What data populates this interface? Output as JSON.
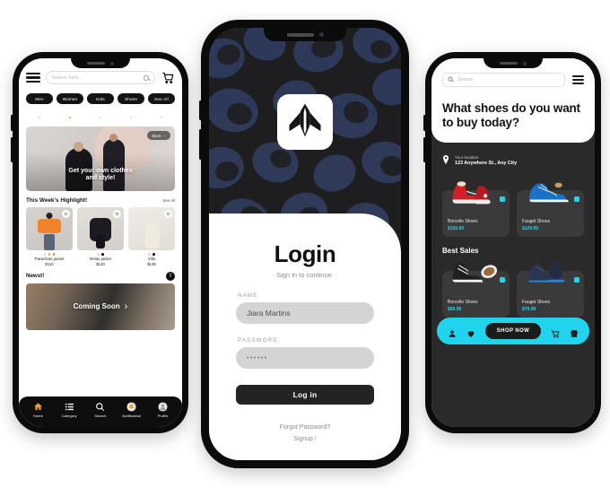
{
  "theme": {
    "accent_cyan": "#22d3ee",
    "accent_orange": "#f0a030",
    "dark": "#131313",
    "page_background": "#ffffff"
  },
  "phone1": {
    "name": "shop-home-screen",
    "header": {
      "menu_icon": "hamburger-icon",
      "search_placeholder": "Search here...",
      "search_icon": "search-icon",
      "cart_icon": "shopping-cart-icon"
    },
    "category_pills": [
      {
        "label": "Men",
        "active": false
      },
      {
        "label": "Woman",
        "active": true
      },
      {
        "label": "Kids",
        "active": false
      },
      {
        "label": "Shoes",
        "active": false
      },
      {
        "label": "See All",
        "active": false
      }
    ],
    "hero": {
      "caption_line1": "Get your own clothes",
      "caption_line2": "and style!",
      "more_label": "More",
      "more_icon": "chevron-right-icon"
    },
    "highlight": {
      "title": "This Week's Highlight!",
      "see_all": "See All",
      "products": [
        {
          "name": "Parachute jacket",
          "price": "$110",
          "swatches": [
            "#d8d8d8",
            "#f0a030",
            "#f0822a"
          ],
          "heart_icon": "heart-icon"
        },
        {
          "name": "Relax jacket",
          "price": "$120",
          "swatches": [
            "#d8d8d8",
            "#1a1a1a"
          ],
          "heart_icon": "heart-icon"
        },
        {
          "name": "Villa",
          "price": "$135",
          "swatches": [
            "#d8d8d8",
            "#1a1a1a"
          ],
          "heart_icon": "heart-icon"
        }
      ]
    },
    "newest": {
      "title": "Newst!",
      "info_icon": "info-icon",
      "banner_label": "Coming Soon",
      "banner_icon": "chevron-right-icon"
    },
    "tabbar": [
      {
        "label": "Home",
        "icon": "home-icon",
        "active": true
      },
      {
        "label": "Category",
        "icon": "list-icon",
        "active": false
      },
      {
        "label": "Search",
        "icon": "search-icon",
        "active": false
      },
      {
        "label": "Notification",
        "icon": "bell-icon",
        "active": false
      },
      {
        "label": "Profile",
        "icon": "user-icon",
        "active": false
      }
    ]
  },
  "phone2": {
    "name": "login-screen",
    "logo_icon": "arrow-plane-logo-icon",
    "title": "Login",
    "subtitle": "Sign in to continue.",
    "name_label": "NAME",
    "name_value": "Jiara Martins",
    "name_placeholder": "Jiara Martins",
    "password_label": "PASSWORD",
    "password_value": "••••••",
    "login_button": "Log in",
    "forgot_password": "Forgot Password?",
    "signup": "Signup !"
  },
  "phone3": {
    "name": "shoes-store-screen",
    "search_placeholder": "Search",
    "search_icon": "search-icon",
    "menu_icon": "hamburger-icon",
    "question": "What shoes do you want to buy today?",
    "location": {
      "icon": "location-pin-icon",
      "label": "Your location",
      "address": "123 Anywhere St., Any City"
    },
    "featured": [
      {
        "name": "Borcelle Shoes",
        "price": "$100.99",
        "image": "red-high-top-sneaker",
        "badge_icon": "square-badge-icon"
      },
      {
        "name": "Fauget Shoes",
        "price": "$129.99",
        "image": "blue-slip-on-shoe",
        "badge_icon": "square-badge-icon"
      }
    ],
    "best_sales_title": "Best Sales",
    "best_sales": [
      {
        "name": "Borcelle Shoes",
        "price": "$89.99",
        "image": "black-white-high-top-sneaker",
        "badge_icon": "square-badge-icon"
      },
      {
        "name": "Fauget Shoes",
        "price": "$79.99",
        "image": "navy-suede-boot",
        "badge_icon": "square-badge-icon"
      }
    ],
    "bottombar": {
      "profile_icon": "user-icon",
      "favorites_icon": "heart-icon",
      "shop_now_label": "SHOP NOW",
      "cart_icon": "shopping-cart-icon",
      "store_icon": "store-icon"
    }
  }
}
